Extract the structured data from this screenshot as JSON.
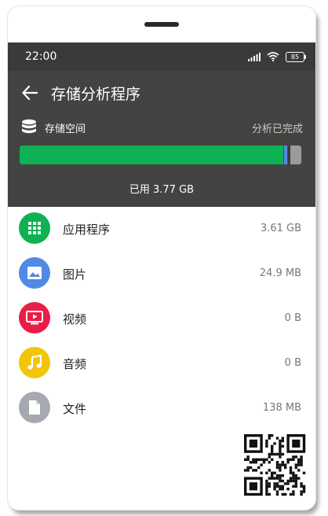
{
  "status_bar": {
    "time": "22:00",
    "battery": "85"
  },
  "toolbar": {
    "title": "存储分析程序"
  },
  "storage": {
    "label": "存储空间",
    "status": "分析已完成",
    "used_text": "已用 3.77 GB",
    "bar": {
      "used_fraction": 0.937
    }
  },
  "categories": [
    {
      "label": "应用程序",
      "size": "3.61 GB",
      "icon": "apps-grid-icon",
      "color": "#0eb252"
    },
    {
      "label": "图片",
      "size": "24.9 MB",
      "icon": "image-icon",
      "color": "#5189e6"
    },
    {
      "label": "视频",
      "size": "0 B",
      "icon": "video-icon",
      "color": "#ea1d48"
    },
    {
      "label": "音频",
      "size": "0 B",
      "icon": "music-icon",
      "color": "#f2c50b"
    },
    {
      "label": "文件",
      "size": "138 MB",
      "icon": "document-icon",
      "color": "#a6a8b2"
    }
  ],
  "colors": {
    "header": "#434341",
    "status_bar": "#3a3a38",
    "used_bar": "#0eb252",
    "free_bar": "#9b9b9b"
  }
}
